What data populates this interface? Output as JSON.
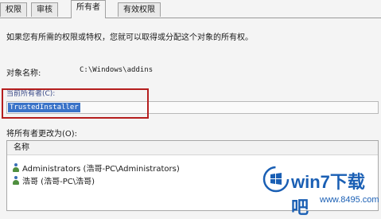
{
  "tabs": [
    "权限",
    "审核",
    "所有者",
    "有效权限"
  ],
  "active_tab": 2,
  "intro_text": "如果您有所需的权限或特权，您就可以取得或分配这个对象的所有权。",
  "object_name": {
    "label": "对象名称:",
    "value": "C:\\Windows\\addins"
  },
  "current_owner": {
    "label": "当前所有者(C):",
    "value": "TrustedInstaller"
  },
  "change_owner_label": "将所有者更改为(O):",
  "owner_list": {
    "header": "名称",
    "items": [
      {
        "icon": "user-icon",
        "text": "Administrators (浩哥-PC\\Administrators)"
      },
      {
        "icon": "user-icon",
        "text": "浩哥 (浩哥-PC\\浩哥)"
      }
    ]
  },
  "watermark": {
    "brand": "win7下载吧",
    "url": "www.8495.com"
  },
  "colors": {
    "selection": "#3a73c8",
    "highlight_box": "#b51e1e",
    "logo": "#1a5fb4"
  }
}
